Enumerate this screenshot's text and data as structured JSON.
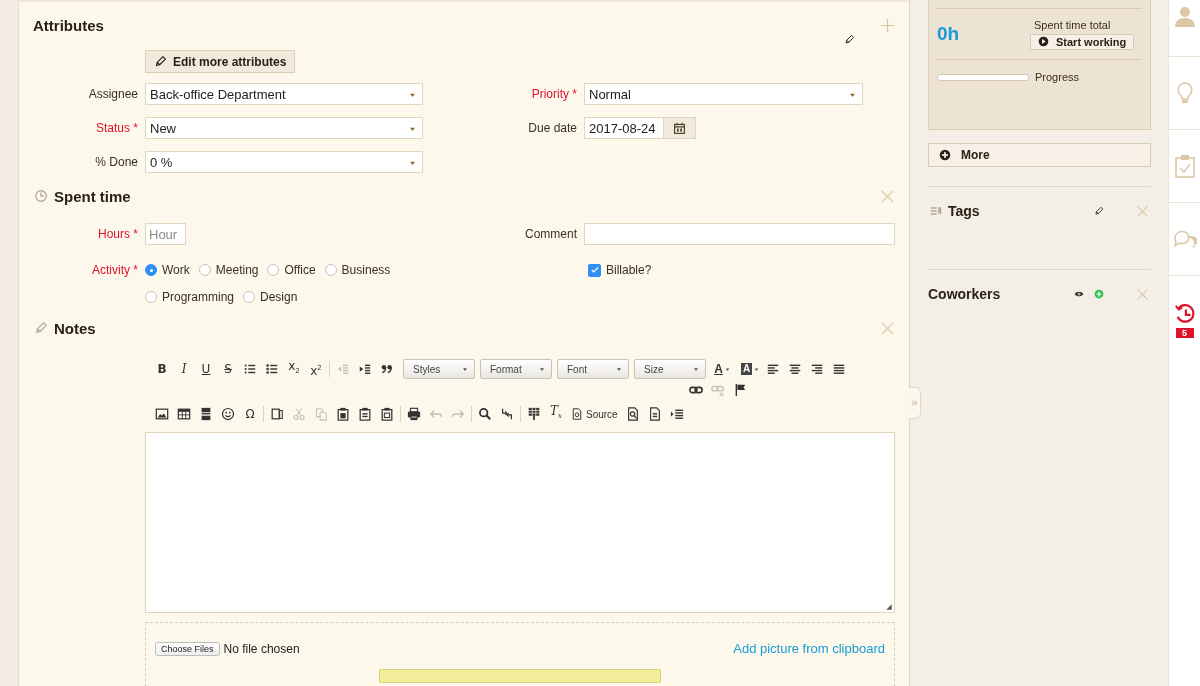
{
  "attributes": {
    "title": "Attributes",
    "edit_button": "Edit more attributes",
    "fields": [
      {
        "label": "Assignee",
        "required": false,
        "kind": "select",
        "value": "Back-office Department"
      },
      {
        "label": "Priority *",
        "required": true,
        "kind": "select",
        "value": "Normal"
      },
      {
        "label": "Status *",
        "required": true,
        "kind": "select",
        "value": "New"
      },
      {
        "label": "Due date",
        "required": false,
        "kind": "date",
        "value": "2017-08-24"
      },
      {
        "label": "% Done",
        "required": false,
        "kind": "select",
        "value": "0 %"
      }
    ]
  },
  "spent_time": {
    "title": "Spent time",
    "hours": {
      "label": "Hours *",
      "required": true,
      "placeholder": "Hour"
    },
    "comment": {
      "label": "Comment",
      "required": false
    },
    "activity": {
      "label": "Activity *",
      "required": true,
      "options": [
        {
          "label": "Work",
          "selected": true
        },
        {
          "label": "Meeting",
          "selected": false
        },
        {
          "label": "Office",
          "selected": false
        },
        {
          "label": "Business",
          "selected": false
        },
        {
          "label": "Programming",
          "selected": false
        },
        {
          "label": "Design",
          "selected": false
        }
      ]
    },
    "billable": {
      "label": "Billable?",
      "checked": true
    }
  },
  "notes": {
    "title": "Notes",
    "toolbar_rows": [
      {
        "groups": [
          {
            "items": [
              {
                "kind": "glyph",
                "label": "B",
                "disabled": false
              },
              {
                "kind": "glyph",
                "label": "I",
                "disabled": false
              },
              {
                "kind": "glyph",
                "label": "U",
                "disabled": false
              },
              {
                "kind": "glyph",
                "label": "S",
                "disabled": false
              },
              {
                "kind": "icon",
                "disabled": false
              },
              {
                "kind": "icon",
                "disabled": false
              },
              {
                "kind": "glyph",
                "label": "x$_{2}$",
                "disabled": false
              },
              {
                "kind": "glyph",
                "label": "x$^{2}$",
                "disabled": false
              }
            ]
          },
          {
            "items": [
              {
                "kind": "icon",
                "disabled": true
              },
              {
                "kind": "icon",
                "disabled": false
              },
              {
                "kind": "icon",
                "disabled": false
              },
              {
                "kind": "dropdown",
                "label": "Styles",
                "disabled": false
              },
              {
                "kind": "dropdown",
                "label": "Format",
                "disabled": false
              },
              {
                "kind": "dropdown",
                "label": "Font",
                "disabled": false
              },
              {
                "kind": "dropdown",
                "label": "Size",
                "disabled": false
              },
              {
                "kind": "text-color",
                "label": "A",
                "disabled": false
              },
              {
                "kind": "back-color",
                "label": "A",
                "disabled": false
              },
              {
                "kind": "icon",
                "disabled": false
              },
              {
                "kind": "icon",
                "disabled": false
              },
              {
                "kind": "icon",
                "disabled": false
              },
              {
                "kind": "icon",
                "disabled": false
              }
            ]
          }
        ]
      },
      {
        "groups": [
          {
            "items": [
              {
                "kind": "icon",
                "disabled": false
              },
              {
                "kind": "icon",
                "disabled": true
              },
              {
                "kind": "icon",
                "disabled": false
              }
            ]
          }
        ]
      },
      {
        "groups": [
          {
            "items": [
              {
                "kind": "icon",
                "disabled": false
              },
              {
                "kind": "icon",
                "disabled": false
              },
              {
                "kind": "icon",
                "disabled": false
              },
              {
                "kind": "icon",
                "disabled": false
              },
              {
                "kind": "glyph",
                "label": "Ω",
                "disabled": false
              }
            ]
          },
          {
            "items": [
              {
                "kind": "icon",
                "disabled": false
              },
              {
                "kind": "icon",
                "disabled": true
              },
              {
                "kind": "icon",
                "disabled": true
              },
              {
                "kind": "icon",
                "disabled": false
              },
              {
                "kind": "icon",
                "disabled": false
              },
              {
                "kind": "icon",
                "disabled": false
              }
            ]
          },
          {
            "items": [
              {
                "kind": "icon",
                "disabled": false
              },
              {
                "kind": "icon",
                "disabled": true
              },
              {
                "kind": "icon",
                "disabled": true
              }
            ]
          },
          {
            "items": [
              {
                "kind": "icon",
                "disabled": false
              },
              {
                "kind": "icon",
                "disabled": false
              }
            ]
          },
          {
            "items": [
              {
                "kind": "icon",
                "disabled": false
              },
              {
                "kind": "glyph",
                "label": "T$_{x}$",
                "disabled": false
              },
              {
                "kind": "source",
                "label": "Source",
                "disabled": false
              },
              {
                "kind": "icon",
                "disabled": false
              },
              {
                "kind": "icon",
                "disabled": false
              },
              {
                "kind": "icon",
                "disabled": false
              }
            ]
          }
        ]
      }
    ],
    "file_button": "Choose Files",
    "file_status": "No file chosen",
    "clipboard_link": "Add picture from clipboard"
  },
  "sidebar": {
    "toggle": "»",
    "spent_total": "0h",
    "spent_label": "Spent time total",
    "start_button": "Start working",
    "progress": {
      "label": "Progress",
      "level": 0
    },
    "more_button": "More",
    "tags": {
      "title": "Tags"
    },
    "coworkers": {
      "title": "Coworkers"
    }
  },
  "rail": {
    "history_badge": "5"
  }
}
